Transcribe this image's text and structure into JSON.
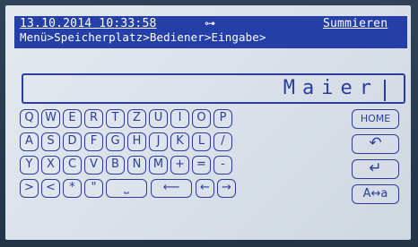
{
  "status": {
    "datetime": "13.10.2014 10:33:58",
    "key_indicator": "⊶",
    "mode": "Summieren"
  },
  "breadcrumb": "Menü>Speicherplatz>Bediener>Eingabe>",
  "input": {
    "value": "Maier"
  },
  "keyboard": {
    "row1": [
      "Q",
      "W",
      "E",
      "R",
      "T",
      "Z",
      "U",
      "I",
      "O",
      "P"
    ],
    "row2": [
      "A",
      "S",
      "D",
      "F",
      "G",
      "H",
      "J",
      "K",
      "L",
      "/"
    ],
    "row3": [
      "Y",
      "X",
      "C",
      "V",
      "B",
      "N",
      "M",
      "+",
      "=",
      "-"
    ],
    "row4": [
      ">",
      "<",
      "*",
      "\"",
      "⎵",
      "⟵",
      "←",
      "→"
    ]
  },
  "side_keys": {
    "home": "HOME",
    "back": "↶",
    "enter": "↵",
    "case": "A↔a"
  },
  "colors": {
    "bar": "#2440a8",
    "ink": "#2b3ea0",
    "lcd": "#dfe5ec"
  }
}
